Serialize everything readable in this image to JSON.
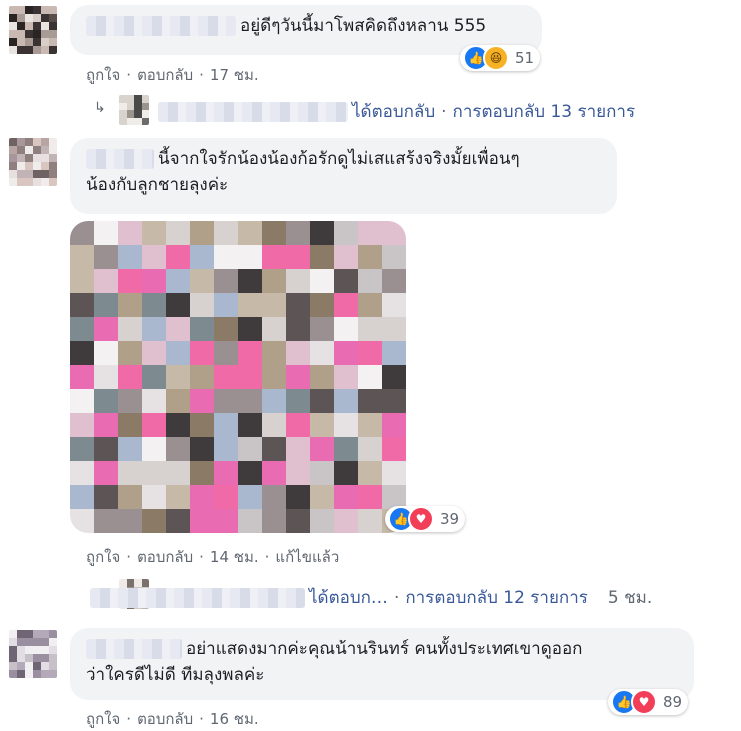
{
  "comments": [
    {
      "text": "อยู่ดีๆวันนี้มาโพสคิดถึงหลาน 555",
      "reactions": {
        "icons": [
          "like-icon",
          "haha-icon"
        ],
        "count": "51"
      },
      "actions": {
        "like": "ถูกใจ",
        "reply": "ตอบกลับ",
        "time": "17 ชม."
      },
      "replies": {
        "replied": "ได้ตอบกลับ",
        "summary": "การตอบกลับ 13 รายการ"
      }
    },
    {
      "text_line1": "นี้จากใจรักน้องน้องก้อรักดูไม่เสแสร้งจริงมั้ยเพื่อนๆ",
      "text_line2": "น้องกับลูกชายลุงค่ะ",
      "reactions": {
        "icons": [
          "like-icon",
          "love-icon"
        ],
        "count": "39"
      },
      "actions": {
        "like": "ถูกใจ",
        "reply": "ตอบกลับ",
        "time": "14 ชม.",
        "edited": "แก้ไขแล้ว"
      },
      "replies": {
        "replied": "ได้ตอบก…",
        "summary": "การตอบกลับ 12 รายการ",
        "time": "5 ชม."
      }
    },
    {
      "text_line1": "อย่าแสดงมากค่ะคุณน้านรินทร์ คนทั้งประเทศเขาดูออก",
      "text_line2": "ว่าใครดีไม่ดี ทีมลุงพลค่ะ",
      "reactions": {
        "icons": [
          "like-icon",
          "love-icon"
        ],
        "count": "89"
      },
      "actions": {
        "like": "ถูกใจ",
        "reply": "ตอบกลับ",
        "time": "16 ชม."
      }
    }
  ],
  "separator": "·",
  "colors": {
    "link": "#385898",
    "muted": "#606770",
    "bubble": "#f2f3f5",
    "like": "#1877f2",
    "love": "#f33e58",
    "haha": "#f7b125"
  }
}
